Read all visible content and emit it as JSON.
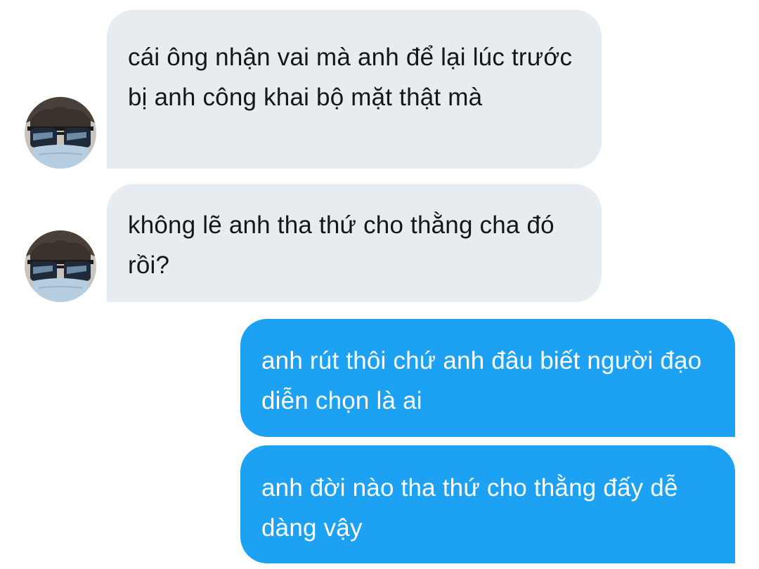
{
  "conversation": {
    "messages": [
      {
        "direction": "incoming",
        "text": "cái ông nhận vai mà anh để lại lúc trước bị anh công khai bộ mặt thật mà",
        "avatar_icon": "user-avatar-icon"
      },
      {
        "direction": "incoming",
        "text": "không lẽ anh tha thứ cho thằng cha đó rồi?",
        "avatar_icon": "user-avatar-icon"
      },
      {
        "direction": "outgoing",
        "text": "anh rút thôi chứ anh đâu biết người đạo diễn chọn là ai"
      },
      {
        "direction": "outgoing",
        "text": "anh đời nào tha thứ cho thằng đấy dễ dàng vậy"
      }
    ]
  },
  "colors": {
    "incoming_bubble": "#e6ecf0",
    "incoming_text": "#14171a",
    "outgoing_bubble": "#1da1f2",
    "outgoing_text": "#ffffff",
    "background": "#ffffff"
  }
}
